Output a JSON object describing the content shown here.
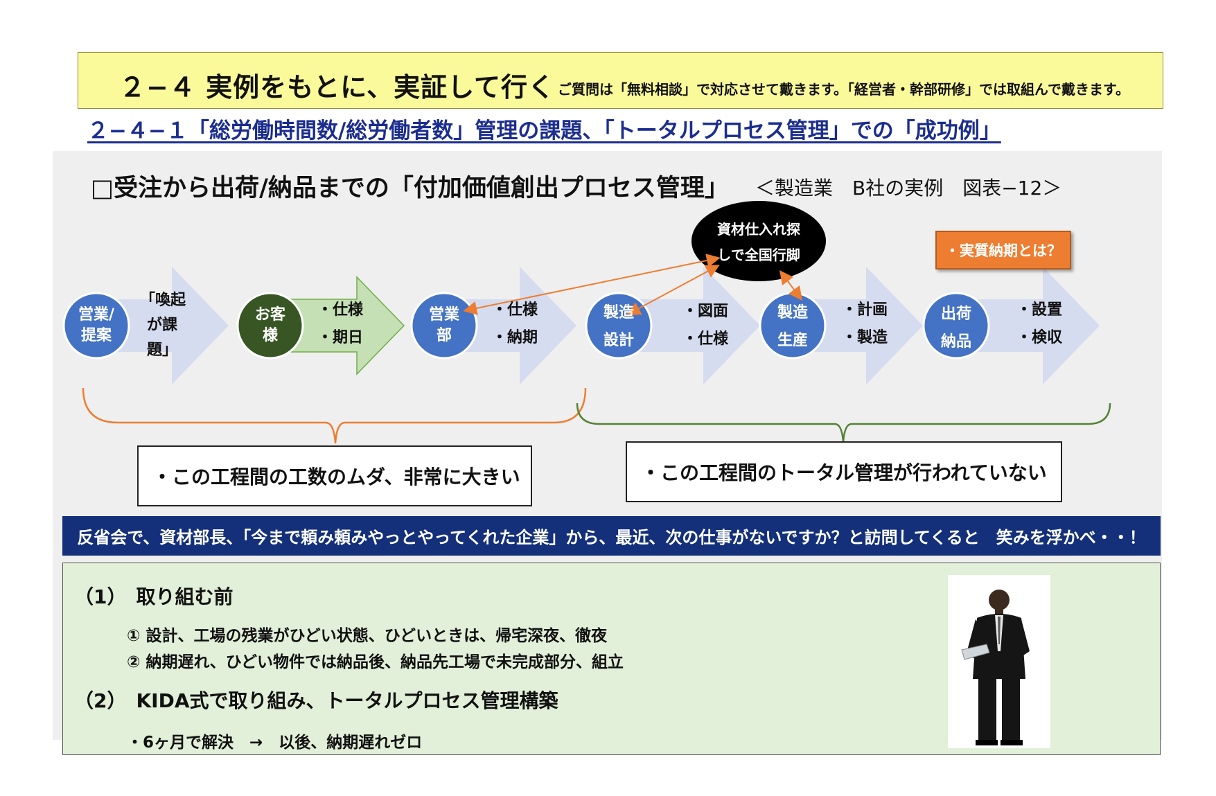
{
  "header": {
    "title": "２−４ 実例をもとに、実証して行く",
    "note": "ご質問は「無料相談」で対応させて戴きます。「経営者・幹部研修」では取組んで戴きます。"
  },
  "subtitle": "２−４−１「総労働時間数/総労働者数」管理の課題、「トータルプロセス管理」での「成功例」",
  "flow": {
    "title": "□受注から出荷/納品までの「付加価値創出プロセス管理」",
    "source": "＜製造業　B社の実例　図表−12＞",
    "steps": [
      {
        "label": [
          "営業/",
          "提案"
        ],
        "text": [
          "「喚起",
          "が課",
          "題」"
        ]
      },
      {
        "label": [
          "お客",
          "様"
        ],
        "text": [
          "・仕様",
          "・期日"
        ]
      },
      {
        "label": [
          "営業",
          "部"
        ],
        "text": [
          "・仕様",
          "・納期"
        ]
      },
      {
        "label": [
          "製造",
          "設計"
        ],
        "text": [
          "・図面",
          "・仕様"
        ]
      },
      {
        "label": [
          "製造",
          "生産"
        ],
        "text": [
          "・計画",
          "・製造"
        ]
      },
      {
        "label": [
          "出荷",
          "納品"
        ],
        "text": [
          "・設置",
          "・検収"
        ]
      }
    ],
    "ellipse": [
      "資材仕入れ探",
      "しで全国行脚"
    ],
    "note": "・実質納期とは？",
    "callout_left": "・この工程間の工数のムダ、非常に大きい",
    "callout_right": "・この工程間のトータル管理が行われていない",
    "colors": {
      "circle": "#4472c4",
      "arrow": "#d6dcef",
      "green_circle": "#375623",
      "green_arrow": "#c5e0b4",
      "orange": "#ed7d31",
      "green_line": "#548235"
    }
  },
  "banner": "反省会で、資材部長、「今まで頼み頼みやっとやってくれた企業」から、最近、次の仕事がないですか？と訪問してくると　笑みを浮かべ・・！",
  "bottom": {
    "head1": "（1）　取り組む前",
    "item1": "①  設計、工場の残業がひどい状態、ひどいときは、帰宅深夜、徹夜",
    "item2": "②  納期遅れ、ひどい物件では納品後、納品先工場で未完成部分、組立",
    "head2": "（2）　KIDA式で取り組み、トータルプロセス管理構築",
    "item3": "・6ヶ月で解決　→　以後、納期遅れゼロ"
  }
}
